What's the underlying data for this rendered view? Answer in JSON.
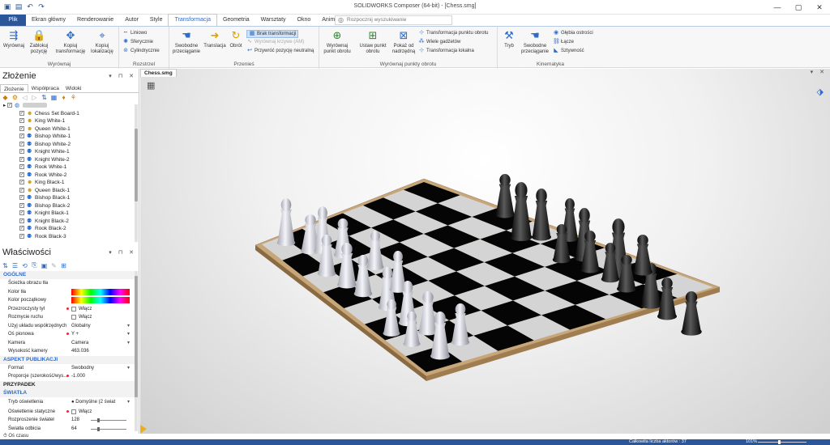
{
  "window": {
    "title": "SOLIDWORKS Composer (64-bit) - [Chess.smg]"
  },
  "tabs": [
    {
      "label": "Plik"
    },
    {
      "label": "Ekran główny"
    },
    {
      "label": "Renderowanie"
    },
    {
      "label": "Autor"
    },
    {
      "label": "Style"
    },
    {
      "label": "Transformacja"
    },
    {
      "label": "Geometria"
    },
    {
      "label": "Warsztaty"
    },
    {
      "label": "Okno"
    },
    {
      "label": "Animuj"
    }
  ],
  "search": {
    "placeholder": "Rozpocznij wyszukiwanie"
  },
  "ribbon": {
    "align": {
      "label": "Wyrównaj",
      "btn1": "Wyrównaj",
      "btn2": "Zablokuj pozycję",
      "btn3": "Kopiuj transformację",
      "btn4": "Kopiuj lokalizację"
    },
    "scatter": {
      "label": "Rozstrzel",
      "linear": "Liniowo",
      "spherical": "Sferycznie",
      "cylindrical": "Cylindrycznie"
    },
    "move": {
      "label": "Przenieś",
      "free": "Swobodne przeciąganie",
      "translate": "Translacja",
      "rotate": "Obrót",
      "no_transform": "Brak transformacji",
      "align_curve": "Wyrównaj krzywe (AM)",
      "restore": "Przywróć pozycję neutralną"
    },
    "pivot": {
      "label": "Wyrównaj punkty obrotu",
      "align_pivot": "Wyrównaj punkt obrotu",
      "set_pivot": "Ustaw punkt obrotu",
      "show_parent": "Pokaż od nadrzędną",
      "tp_transform": "Transformacja punktu obrotu",
      "many_gadgets": "Wiele gadżetów",
      "local_transform": "Transformacja lokalna"
    },
    "kinematics": {
      "label": "Kinematyka",
      "mode": "Tryb",
      "free_drag": "Swobodne przeciąganie",
      "depth": "Głębia ostrości",
      "links": "Łącze",
      "stiffness": "Sztywność"
    }
  },
  "assembly_panel": {
    "title": "Złożenie",
    "subtabs": [
      "Złożenie",
      "Współpraca",
      "Widoki"
    ],
    "tree": [
      "Chess Set Board-1",
      "King White-1",
      "Queen White-1",
      "Bishop White-1",
      "Bishop White-2",
      "Knight White-1",
      "Knight White-2",
      "Rook White-1",
      "Rook White-2",
      "King Black-1",
      "Queen Black-1",
      "Bishop Black-1",
      "Bishop Black-2",
      "Knight Black-1",
      "Knight Black-2",
      "Rook Black-2",
      "Rook Black-3"
    ]
  },
  "properties_panel": {
    "title": "Właściwości",
    "sections": {
      "general": "OGÓLNE",
      "publication": "ASPEKT PUBLIKACJI",
      "cutting": "PRZYPADEK",
      "lights": "ŚWIATŁA"
    },
    "general_rows": [
      {
        "name": "Ścieżka obrazu tła",
        "value": "",
        "kind": "text"
      },
      {
        "name": "Kolor tła",
        "value": "",
        "kind": "rainbow"
      },
      {
        "name": "Kolor początkowy",
        "value": "",
        "kind": "rainbow"
      },
      {
        "name": "Przezroczysty tył",
        "value": "Włącz",
        "kind": "check"
      },
      {
        "name": "Rozmycie ruchu",
        "value": "Włącz",
        "kind": "check"
      },
      {
        "name": "Użyj układu współrzędnych",
        "value": "Globalny",
        "kind": "dd"
      },
      {
        "name": "Oś pionowa",
        "value": "Y +",
        "kind": "dd"
      },
      {
        "name": "Kamera",
        "value": "Camera",
        "kind": "dd"
      },
      {
        "name": "Wysokość kamery",
        "value": "463.036",
        "kind": "text"
      }
    ],
    "publication_rows": [
      {
        "name": "Format",
        "value": "Swobodny",
        "kind": "dd"
      },
      {
        "name": "Proporcje (szerokość/wys...",
        "value": "-1.000",
        "kind": "text"
      }
    ],
    "lights_rows": [
      {
        "name": "Tryb oświetlenia",
        "value": "Domyślne (2 świat",
        "kind": "dd"
      },
      {
        "name": "Oświetlenie statyczne",
        "value": "Włącz",
        "kind": "check"
      },
      {
        "name": "Rozproszenie świateł",
        "value": "128",
        "kind": "slider"
      },
      {
        "name": "Światła odbicia",
        "value": "64",
        "kind": "slider"
      }
    ]
  },
  "document_tab": "Chess.smg",
  "timeline": {
    "label": "Oś czasu"
  },
  "status": {
    "actors": "Całkowita liczba aktorów : 37",
    "zoom": "101%"
  }
}
